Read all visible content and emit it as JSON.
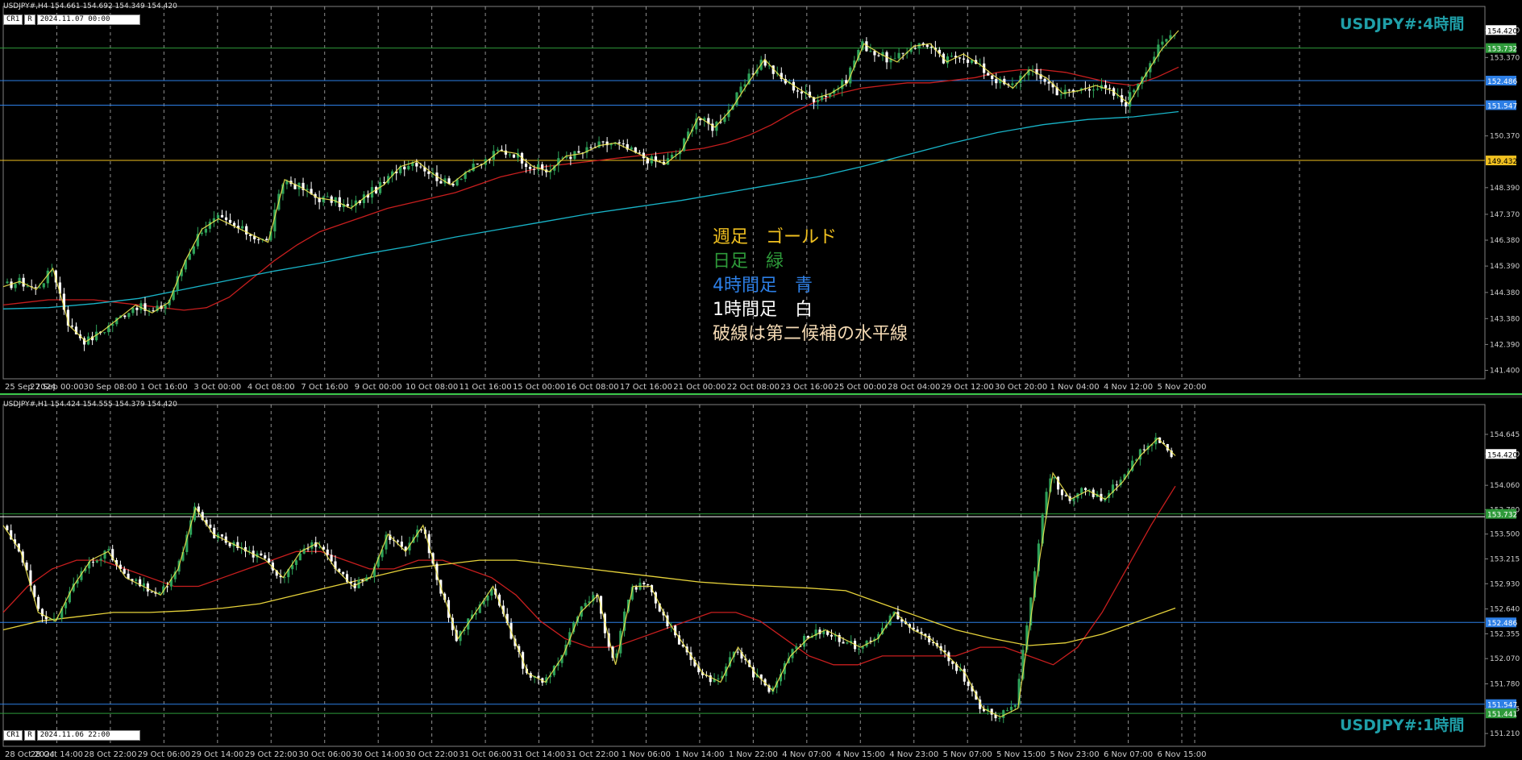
{
  "colors": {
    "background": "#000000",
    "grid": "#bfbfbf",
    "weekly_gold": "#f0c020",
    "daily_green": "#2e9a3a",
    "h4_blue": "#2d7fe6",
    "h1_white": "#ffffff",
    "bull": "#2ea35a",
    "bear": "#ffffff",
    "ma_red": "#c81e1e",
    "ma_cyan": "#18b4c8",
    "ma_yellow": "#e6d23a",
    "zigzag": "#f0e650",
    "axis_text": "#cfcfcf"
  },
  "top_panel": {
    "header": "USDJPY#,H4  154.661 154.692 154.349 154.420",
    "tag_cr": "CR1",
    "tag_r": "R",
    "tag_time": "2024.11.07 00:00",
    "symbol_title": "USDJPY#:4時間",
    "legend": [
      {
        "text": "週足　ゴールド",
        "color": "#f0c020"
      },
      {
        "text": "日足　緑",
        "color": "#2e9a3a"
      },
      {
        "text": "4時間足　青",
        "color": "#2d7fe6"
      },
      {
        "text": "1時間足　白",
        "color": "#ffffff"
      },
      {
        "text": "破線は第二候補の水平線",
        "color": "#f3d9b3"
      }
    ]
  },
  "bottom_panel": {
    "header": "USDJPY#,H1  154.424 154.555 154.379 154.420",
    "tag_cr": "CR1",
    "tag_r": "R",
    "tag_time": "2024.11.06 22:00",
    "symbol_title": "USDJPY#:1時間"
  },
  "chart_data": [
    {
      "type": "candlestick",
      "timeframe": "H4",
      "title": "USDJPY#:4時間",
      "y_ticks": [
        "154.420",
        "153.370",
        "150.370",
        "148.390",
        "147.370",
        "146.380",
        "145.390",
        "144.380",
        "143.380",
        "142.390",
        "141.400"
      ],
      "ylim": [
        141.2,
        155.2
      ],
      "x_ticks": [
        "25 Sep 2024",
        "27 Sep 00:00",
        "30 Sep 08:00",
        "1 Oct 16:00",
        "3 Oct 00:00",
        "4 Oct 08:00",
        "7 Oct 16:00",
        "9 Oct 00:00",
        "10 Oct 08:00",
        "11 Oct 16:00",
        "15 Oct 00:00",
        "16 Oct 08:00",
        "17 Oct 16:00",
        "21 Oct 00:00",
        "22 Oct 08:00",
        "23 Oct 16:00",
        "25 Oct 00:00",
        "28 Oct 04:00",
        "29 Oct 12:00",
        "30 Oct 20:00",
        "1 Nov 04:00",
        "4 Nov 12:00",
        "5 Nov 20:00"
      ],
      "last_price": "154.420",
      "horizontal_lines": [
        {
          "level": 153.732,
          "label": "153.732",
          "color": "#2e9a3a"
        },
        {
          "level": 152.486,
          "label": "152.486",
          "color": "#2d7fe6"
        },
        {
          "level": 151.547,
          "label": "151.547",
          "color": "#2d7fe6"
        },
        {
          "level": 149.432,
          "label": "149.432",
          "color": "#f0c020"
        }
      ],
      "close_path": [
        144.6,
        144.8,
        144.5,
        145.3,
        143.1,
        142.5,
        142.9,
        143.4,
        143.9,
        143.6,
        144.0,
        145.6,
        146.8,
        147.2,
        146.9,
        146.6,
        146.3,
        148.7,
        148.4,
        148.0,
        147.9,
        147.6,
        148.1,
        148.5,
        149.2,
        149.4,
        148.9,
        148.5,
        149.0,
        149.3,
        149.8,
        149.7,
        149.2,
        149.0,
        149.6,
        149.7,
        150.0,
        150.1,
        149.8,
        149.5,
        149.3,
        149.8,
        151.1,
        150.7,
        151.4,
        152.4,
        153.3,
        152.6,
        152.2,
        151.8,
        152.0,
        152.4,
        153.9,
        153.5,
        153.2,
        153.8,
        153.9,
        153.2,
        153.5,
        153.1,
        152.6,
        152.2,
        152.9,
        152.6,
        152.0,
        152.1,
        152.3,
        152.1,
        151.6,
        152.7,
        153.7,
        154.4
      ],
      "series": [
        {
          "name": "MA red",
          "values": [
            143.9,
            144.0,
            144.1,
            144.1,
            144.1,
            144.0,
            143.9,
            143.8,
            143.7,
            143.8,
            144.2,
            144.9,
            145.6,
            146.2,
            146.7,
            147.0,
            147.3,
            147.6,
            147.8,
            148.0,
            148.2,
            148.5,
            148.8,
            149.0,
            149.2,
            149.3,
            149.4,
            149.5,
            149.6,
            149.7,
            149.8,
            149.9,
            150.1,
            150.4,
            150.8,
            151.3,
            151.7,
            152.0,
            152.2,
            152.3,
            152.4,
            152.4,
            152.5,
            152.6,
            152.8,
            152.9,
            152.9,
            152.8,
            152.6,
            152.4,
            152.3,
            152.6,
            153.0
          ]
        },
        {
          "name": "MA cyan",
          "values": [
            143.75,
            143.8,
            143.95,
            144.15,
            144.5,
            144.85,
            145.2,
            145.5,
            145.85,
            146.15,
            146.5,
            146.8,
            147.1,
            147.4,
            147.65,
            147.9,
            148.2,
            148.5,
            148.8,
            149.2,
            149.65,
            150.1,
            150.5,
            150.8,
            151.0,
            151.1,
            151.3
          ]
        }
      ]
    },
    {
      "type": "candlestick",
      "timeframe": "H1",
      "title": "USDJPY#:1時間",
      "y_ticks": [
        "154.645",
        "154.420",
        "154.060",
        "153.780",
        "153.500",
        "153.215",
        "152.930",
        "152.640",
        "152.355",
        "152.070",
        "151.780",
        "151.495",
        "151.210"
      ],
      "ylim": [
        151.1,
        154.95
      ],
      "x_ticks": [
        "28 Oct 2024",
        "28 Oct 14:00",
        "28 Oct 22:00",
        "29 Oct 06:00",
        "29 Oct 14:00",
        "29 Oct 22:00",
        "30 Oct 06:00",
        "30 Oct 14:00",
        "30 Oct 22:00",
        "31 Oct 06:00",
        "31 Oct 14:00",
        "31 Oct 22:00",
        "1 Nov 06:00",
        "1 Nov 14:00",
        "1 Nov 22:00",
        "4 Nov 07:00",
        "4 Nov 15:00",
        "4 Nov 23:00",
        "5 Nov 07:00",
        "5 Nov 15:00",
        "5 Nov 23:00",
        "6 Nov 07:00",
        "6 Nov 15:00"
      ],
      "last_price": "154.420",
      "horizontal_lines": [
        {
          "level": 153.732,
          "label": "153.732",
          "color": "#2e9a3a"
        },
        {
          "level": 153.7,
          "label": "",
          "color": "#ffffff"
        },
        {
          "level": 152.486,
          "label": "152.486",
          "color": "#2d7fe6"
        },
        {
          "level": 151.547,
          "label": "151.547",
          "color": "#2d7fe6"
        },
        {
          "level": 151.441,
          "label": "151.441",
          "color": "#2e9a3a"
        }
      ],
      "close_path": [
        153.6,
        153.3,
        152.6,
        152.5,
        152.9,
        153.2,
        153.3,
        153.0,
        152.9,
        152.8,
        153.1,
        153.8,
        153.5,
        153.4,
        153.3,
        153.2,
        153.0,
        153.3,
        153.4,
        153.1,
        152.9,
        153.0,
        153.5,
        153.3,
        153.6,
        152.9,
        152.3,
        152.6,
        152.9,
        152.4,
        151.9,
        151.8,
        152.1,
        152.6,
        152.8,
        152.0,
        152.9,
        152.9,
        152.5,
        152.2,
        151.9,
        151.8,
        152.2,
        151.9,
        151.7,
        152.1,
        152.3,
        152.4,
        152.3,
        152.2,
        152.3,
        152.6,
        152.4,
        152.3,
        152.1,
        151.9,
        151.5,
        151.4,
        151.5,
        152.9,
        154.2,
        153.9,
        154.0,
        153.9,
        154.1,
        154.4,
        154.6,
        154.4
      ],
      "series": [
        {
          "name": "MA red",
          "values": [
            152.6,
            152.9,
            153.1,
            153.2,
            153.2,
            153.1,
            153.0,
            152.9,
            152.9,
            153.0,
            153.1,
            153.2,
            153.3,
            153.3,
            153.2,
            153.1,
            153.1,
            153.2,
            153.2,
            153.1,
            153.0,
            152.8,
            152.5,
            152.3,
            152.2,
            152.2,
            152.3,
            152.4,
            152.5,
            152.6,
            152.6,
            152.5,
            152.3,
            152.1,
            152.0,
            152.0,
            152.1,
            152.1,
            152.1,
            152.1,
            152.2,
            152.2,
            152.1,
            152.0,
            152.2,
            152.6,
            153.1,
            153.6,
            154.05
          ]
        },
        {
          "name": "MA yellow",
          "values": [
            152.4,
            152.5,
            152.55,
            152.6,
            152.6,
            152.62,
            152.65,
            152.7,
            152.8,
            152.9,
            153.0,
            153.1,
            153.15,
            153.2,
            153.2,
            153.15,
            153.1,
            153.05,
            153.0,
            152.95,
            152.92,
            152.9,
            152.88,
            152.85,
            152.7,
            152.55,
            152.4,
            152.3,
            152.22,
            152.25,
            152.35,
            152.5,
            152.65
          ]
        }
      ]
    }
  ]
}
